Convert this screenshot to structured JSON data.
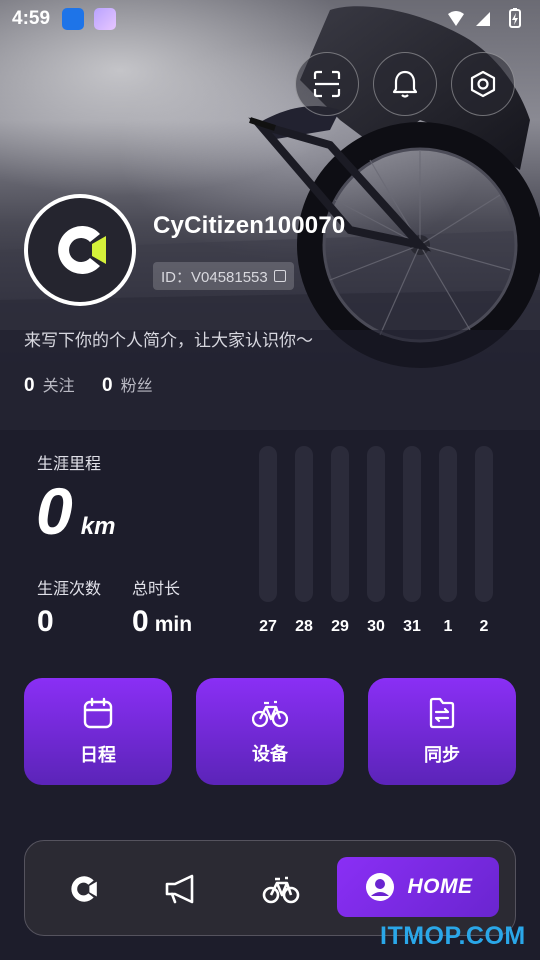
{
  "status_bar": {
    "time": "4:59"
  },
  "profile": {
    "username": "CyCitizen100070",
    "id_text": "ID：V04581553",
    "bio": "来写下你的个人简介，让大家认识你～",
    "following_count": "0",
    "following_label": "关注",
    "followers_count": "0",
    "followers_label": "粉丝"
  },
  "stats": {
    "career_mileage_label": "生涯里程",
    "career_mileage_value": "0",
    "career_mileage_unit": "km",
    "career_rides_label": "生涯次数",
    "career_rides_value": "0",
    "total_duration_label": "总时长",
    "total_duration_value": "0",
    "total_duration_unit": "min"
  },
  "chart_data": {
    "type": "bar",
    "categories": [
      "27",
      "28",
      "29",
      "30",
      "31",
      "1",
      "2"
    ],
    "values": [
      0,
      0,
      0,
      0,
      0,
      0,
      0
    ]
  },
  "actions": [
    {
      "label": "日程",
      "icon": "calendar-icon"
    },
    {
      "label": "设备",
      "icon": "bike-icon"
    },
    {
      "label": "同步",
      "icon": "sync-file-icon"
    }
  ],
  "nav": {
    "home_label": "HOME"
  },
  "watermark": "ITMOP.COM",
  "colors": {
    "accent": "#8a2ff5",
    "background": "#1d1d2b",
    "logo_accent": "#d4f13a"
  }
}
